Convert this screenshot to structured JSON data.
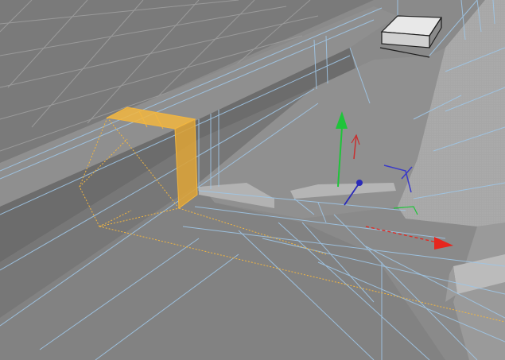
{
  "viewport": {
    "view": "perspective",
    "colors": {
      "background": "#878787",
      "floor_dark": "#6e6e6e",
      "floor_mid": "#7b7b7b",
      "grid_line": "#9a9a9a",
      "wire_blue": "#9fc6e6",
      "wire_blue_soft": "#a9cfee",
      "selection_orange": "#f2b640",
      "selection_fill": "#d9a23a",
      "black_wire": "#1d1d1d",
      "axis_y": "#1fc43a",
      "axis_x": "#e6261e",
      "axis_z": "#2a2ab8",
      "wall_light": "#a9a9a9",
      "wall_top": "#9a9a9a"
    }
  },
  "gizmo": {
    "icon": "move-tool-gizmo-icon",
    "axes": [
      "y-axis-arrow-icon",
      "x-axis-arrow-icon",
      "z-axis-arrow-icon"
    ]
  },
  "selection": {
    "icon": "selected-mesh-highlight"
  }
}
